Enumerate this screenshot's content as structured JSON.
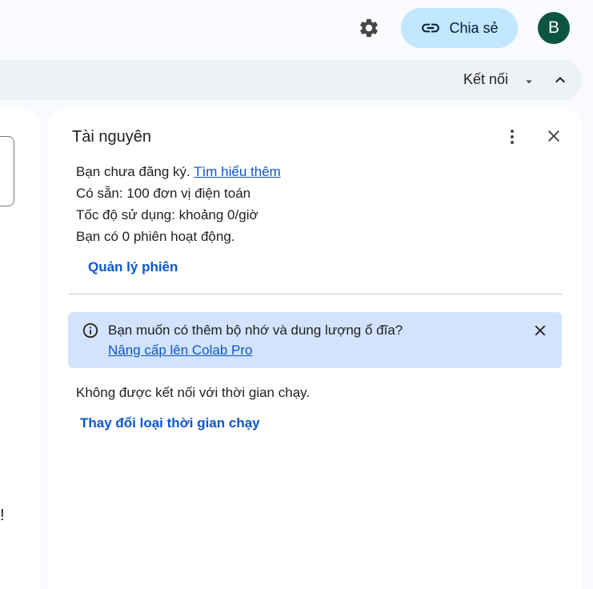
{
  "header": {
    "share_label": "Chia sẻ",
    "avatar_initial": "B"
  },
  "connect_bar": {
    "label": "Kết nối"
  },
  "left_panel": {
    "partial_text": "!"
  },
  "resources": {
    "title": "Tài nguyên",
    "not_subscribed": "Bạn chưa đăng ký.",
    "learn_more": "Tìm hiểu thêm",
    "available": "Có sẵn: 100 đơn vị điện toán",
    "usage_rate": "Tốc độ sử dụng: khoảng 0/giờ",
    "sessions": "Bạn có 0 phiên hoạt động.",
    "manage_sessions": "Quản lý phiên",
    "banner": {
      "text": "Bạn muốn có thêm bộ nhớ và dung lượng ổ đĩa?",
      "link": "Nâng cấp lên Colab Pro"
    },
    "runtime_status": "Không được kết nối với thời gian chạy.",
    "change_runtime": "Thay đổi loại thời gian chạy"
  },
  "colors": {
    "share_bg": "#c2e7ff",
    "avatar_bg": "#0b5442",
    "link": "#0b57d0",
    "banner_bg": "#d3e3fd"
  },
  "icons": [
    "gear-icon",
    "link-icon",
    "caret-down-icon",
    "chevron-up-icon",
    "more-vert-icon",
    "close-icon",
    "info-icon"
  ]
}
